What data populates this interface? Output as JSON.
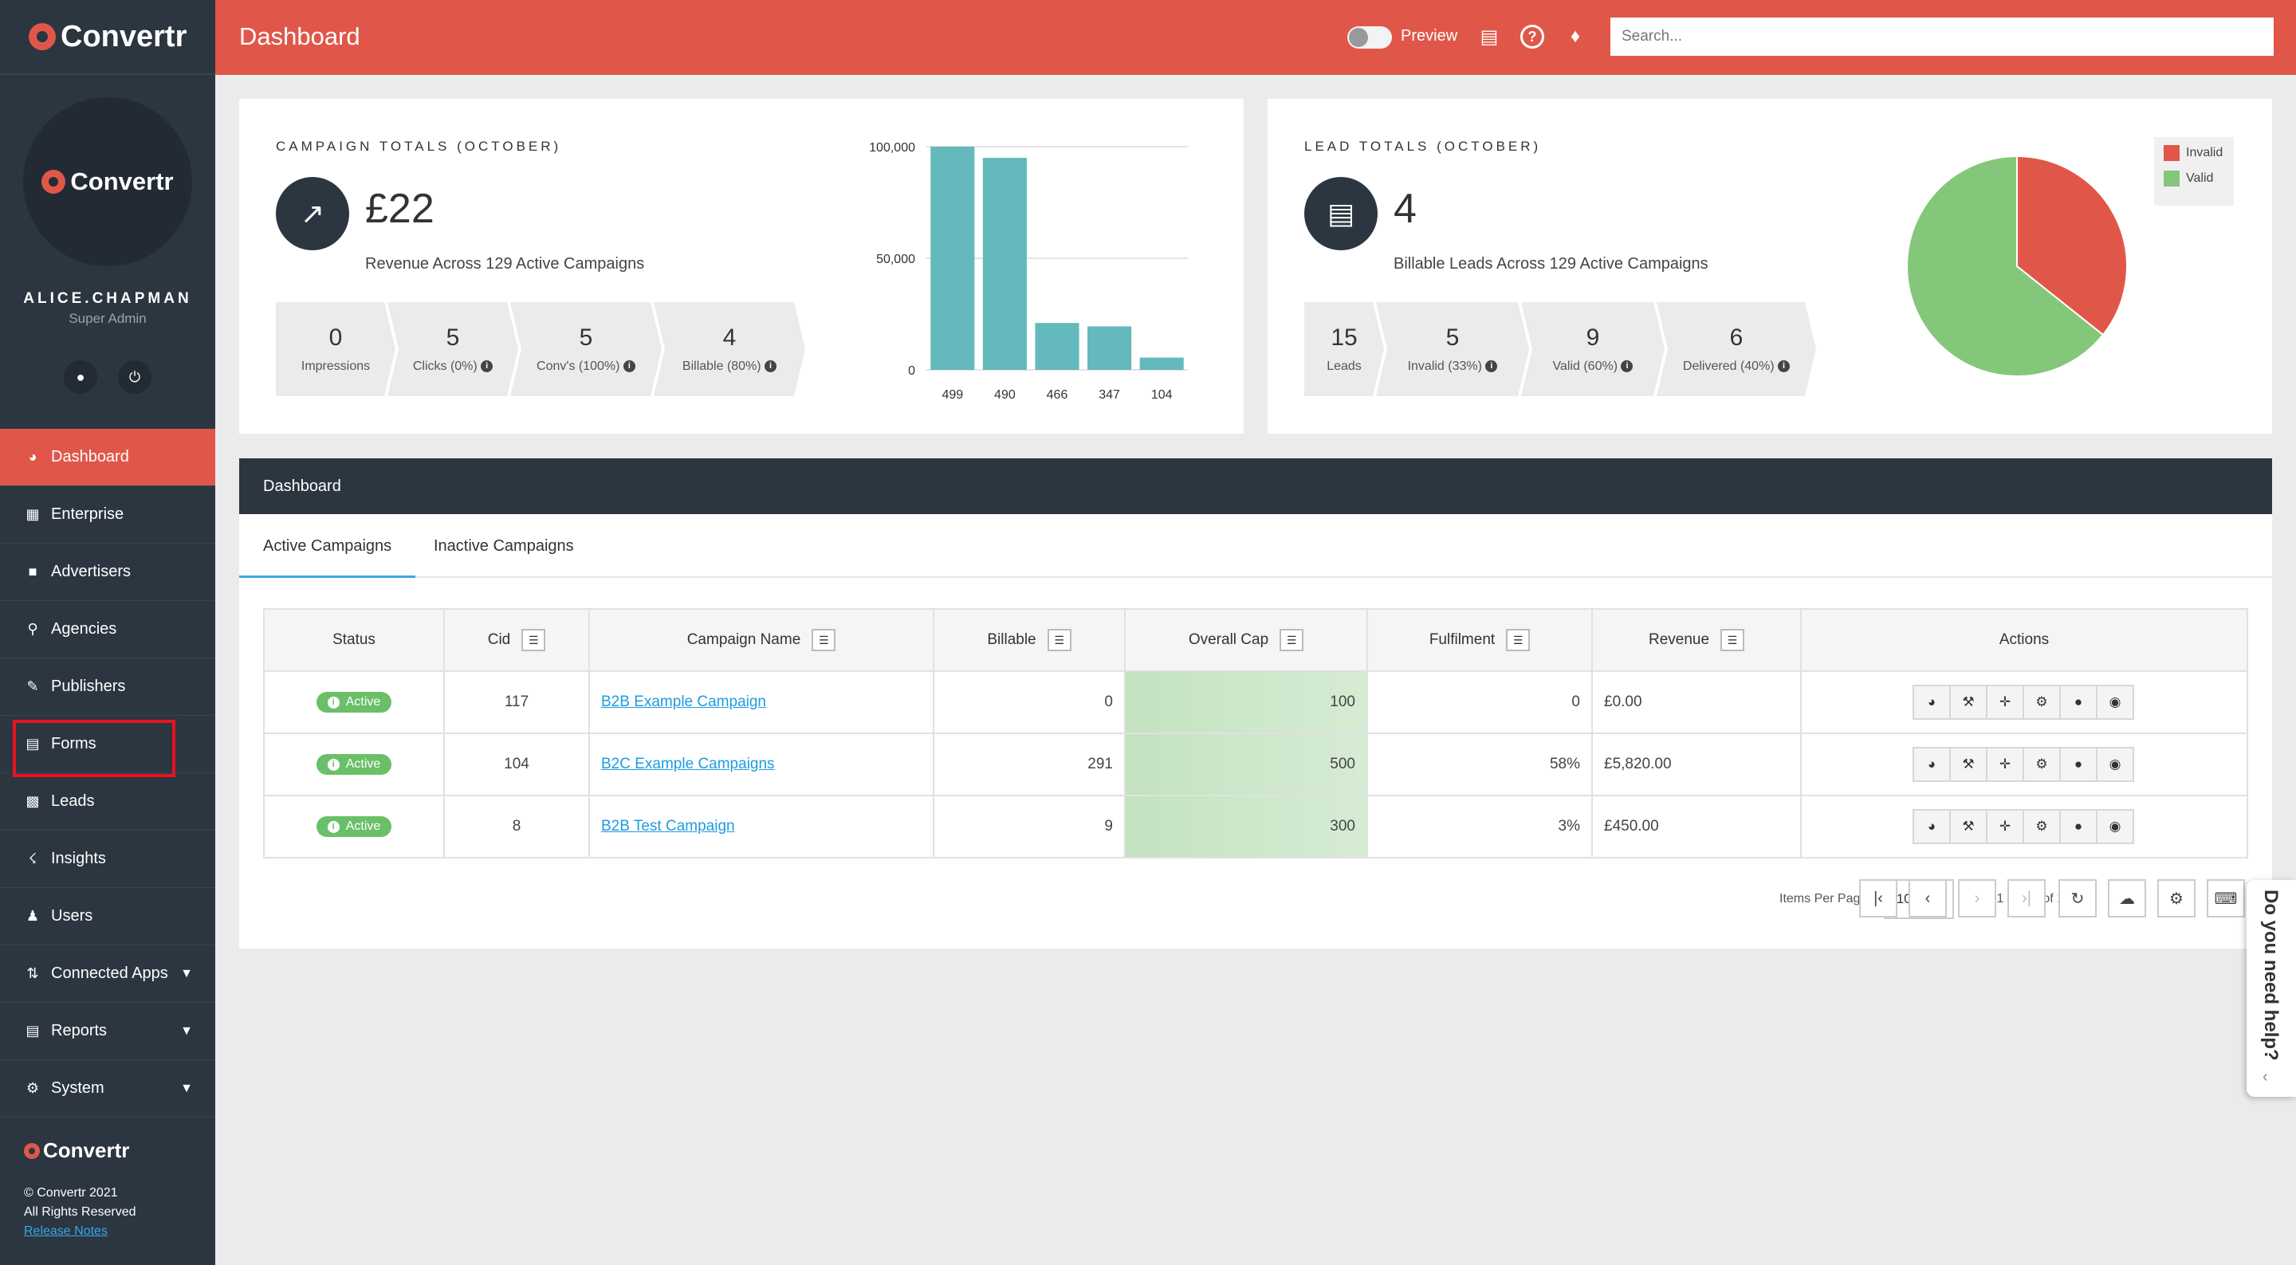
{
  "app": {
    "brand": "Convertr",
    "page_title": "Dashboard"
  },
  "colors": {
    "accent": "#e0574a",
    "sidebar": "#2b3640",
    "bars": "#63b9bb",
    "valid": "#84c77a",
    "invalid": "#e0574a",
    "active": "#6abf69",
    "link": "#1f9be0"
  },
  "user": {
    "name": "ALICE.CHAPMAN",
    "role": "Super Admin",
    "profile_icon": "user-icon",
    "logout_icon": "power-icon"
  },
  "sidebar": {
    "items": [
      {
        "label": "Dashboard",
        "icon": "dashboard-icon"
      },
      {
        "label": "Enterprise",
        "icon": "building-icon"
      },
      {
        "label": "Advertisers",
        "icon": "advertisers-icon"
      },
      {
        "label": "Agencies",
        "icon": "agencies-icon"
      },
      {
        "label": "Publishers",
        "icon": "publishers-icon"
      },
      {
        "label": "Forms",
        "icon": "forms-icon"
      },
      {
        "label": "Leads",
        "icon": "leads-icon"
      },
      {
        "label": "Insights",
        "icon": "insights-icon"
      },
      {
        "label": "Users",
        "icon": "users-icon"
      },
      {
        "label": "Connected Apps",
        "icon": "connected-apps-icon"
      },
      {
        "label": "Reports",
        "icon": "reports-icon"
      },
      {
        "label": "System",
        "icon": "gear-icon"
      }
    ],
    "footer": {
      "brand": "Convertr",
      "copyright": "© Convertr 2021",
      "rights": "All Rights Reserved",
      "release_notes": "Release Notes"
    }
  },
  "topbar": {
    "preview_label": "Preview",
    "search_placeholder": "Search..."
  },
  "campaign_totals": {
    "title": "CAMPAIGN TOTALS (OCTOBER)",
    "value": "£22",
    "subtitle": "Revenue Across 129 Active Campaigns",
    "stats": [
      {
        "value": "0",
        "label": "Impressions"
      },
      {
        "value": "5",
        "label": "Clicks (0%)"
      },
      {
        "value": "5",
        "label": "Conv's (100%)"
      },
      {
        "value": "4",
        "label": "Billable (80%)"
      }
    ]
  },
  "lead_totals": {
    "title": "LEAD TOTALS (OCTOBER)",
    "value": "4",
    "subtitle": "Billable Leads Across 129 Active Campaigns",
    "stats": [
      {
        "value": "15",
        "label": "Leads"
      },
      {
        "value": "5",
        "label": "Invalid (33%)"
      },
      {
        "value": "9",
        "label": "Valid (60%)"
      },
      {
        "value": "6",
        "label": "Delivered (40%)"
      }
    ]
  },
  "chart_data": [
    {
      "type": "bar",
      "categories": [
        "499",
        "490",
        "466",
        "347",
        "104"
      ],
      "values": [
        100000,
        95000,
        21000,
        19500,
        5500
      ],
      "ylim": [
        0,
        100000
      ],
      "yticks": [
        "0",
        "50,000",
        "100,000"
      ],
      "grid": true
    },
    {
      "type": "pie",
      "labels": [
        "Invalid",
        "Valid"
      ],
      "values": [
        5,
        9
      ],
      "legend": "top-right"
    }
  ],
  "panel": {
    "title": "Dashboard",
    "tabs": [
      "Active Campaigns",
      "Inactive Campaigns"
    ],
    "columns": [
      "Status",
      "Cid",
      "Campaign Name",
      "Billable",
      "Overall Cap",
      "Fulfilment",
      "Revenue",
      "Actions"
    ],
    "rows": [
      {
        "status": "Active",
        "cid": "117",
        "name": "B2B Example Campaign",
        "billable": "0",
        "cap": "100",
        "fulfilment": "0",
        "revenue": "£0.00"
      },
      {
        "status": "Active",
        "cid": "104",
        "name": "B2C Example Campaigns",
        "billable": "291",
        "cap": "500",
        "fulfilment": "58%",
        "revenue": "£5,820.00"
      },
      {
        "status": "Active",
        "cid": "8",
        "name": "B2B Test Campaign",
        "billable": "9",
        "cap": "300",
        "fulfilment": "3%",
        "revenue": "£450.00"
      }
    ],
    "action_icons": [
      "dashboard-icon",
      "wrench-icon",
      "move-icon",
      "gear-icon",
      "user-icon",
      "eye-icon"
    ],
    "pager": {
      "items_per_page_label": "Items Per Page:",
      "items_per_page": "10",
      "range": "101 – 103 of 103"
    }
  },
  "help": {
    "label": "Do you need help?"
  }
}
